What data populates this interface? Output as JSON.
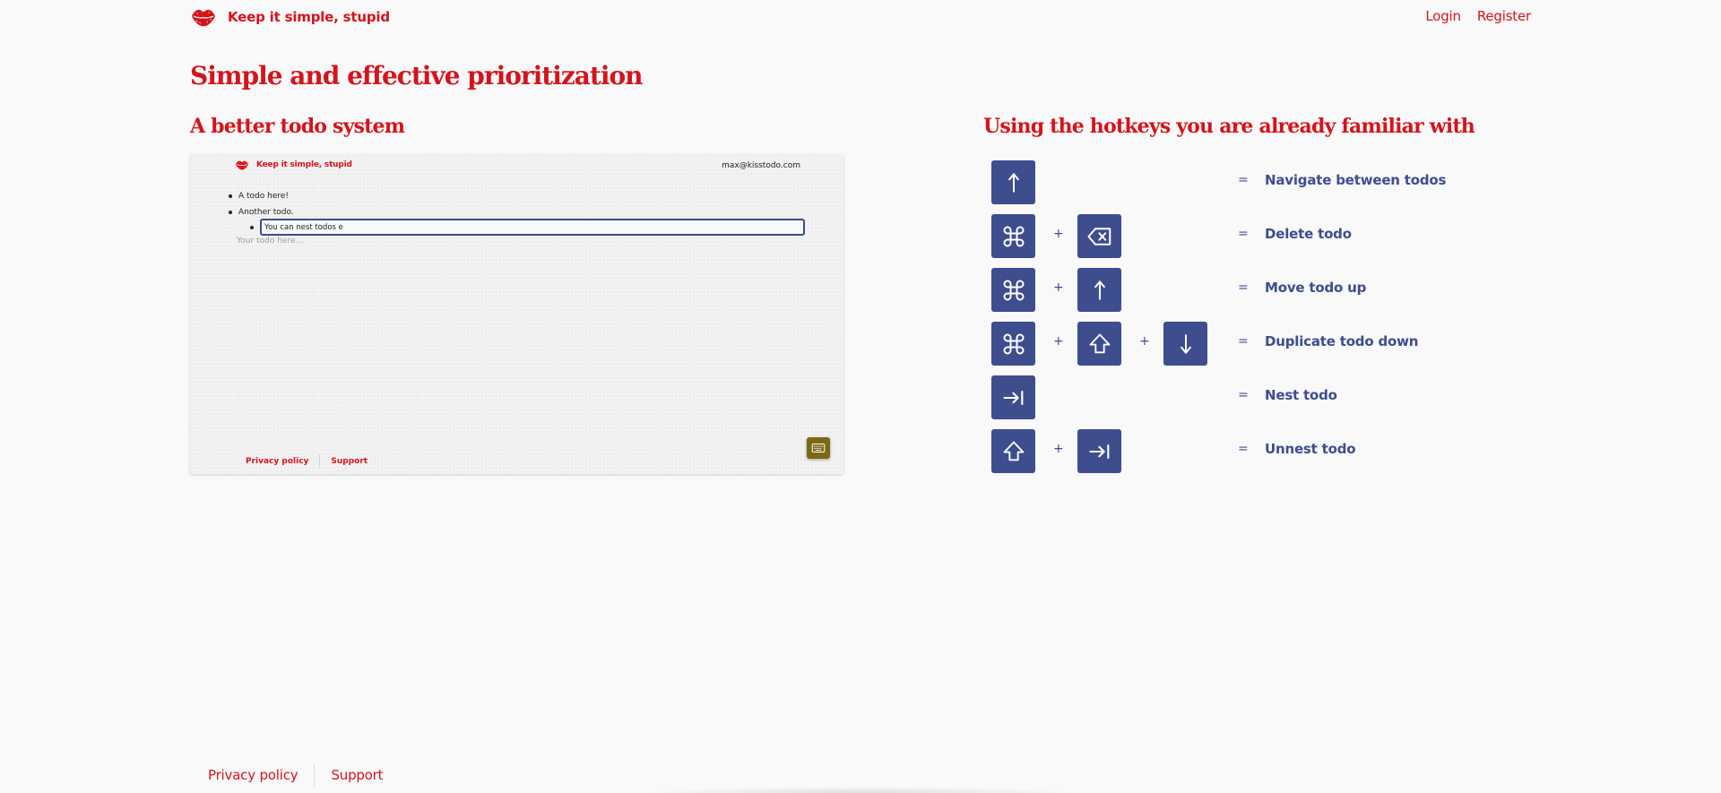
{
  "header": {
    "brand_name": "Keep it simple, stupid",
    "logo_icon": "lips-icon",
    "nav": {
      "login": "Login",
      "register": "Register"
    }
  },
  "hero": {
    "title": "Simple and effective prioritization"
  },
  "left_section": {
    "title": "A better todo system"
  },
  "right_section": {
    "title": "Using the hotkeys you are already familiar with"
  },
  "preview": {
    "brand_name": "Keep it simple, stupid",
    "email": "max@kisstodo.com",
    "todos": [
      "A todo here!",
      "Another todo."
    ],
    "nested_input_value": "You can nest todos e",
    "placeholder": "Your todo here...",
    "footer": {
      "privacy": "Privacy policy",
      "support": "Support"
    },
    "keyboard_button_icon": "keyboard-icon"
  },
  "hotkeys": {
    "plus": "+",
    "equals": "=",
    "rows": [
      {
        "keys": [
          "arrow-up-icon"
        ],
        "description": "Navigate between todos"
      },
      {
        "keys": [
          "command-icon",
          "backspace-icon"
        ],
        "description": "Delete todo"
      },
      {
        "keys": [
          "command-icon",
          "arrow-up-icon"
        ],
        "description": "Move todo up"
      },
      {
        "keys": [
          "command-icon",
          "shift-icon",
          "arrow-down-icon"
        ],
        "description": "Duplicate todo down"
      },
      {
        "keys": [
          "tab-icon"
        ],
        "description": "Nest todo"
      },
      {
        "keys": [
          "shift-icon",
          "tab-icon"
        ],
        "description": "Unnest todo"
      }
    ]
  },
  "footer": {
    "privacy": "Privacy policy",
    "support": "Support"
  },
  "colors": {
    "accent": "#d4141b",
    "key_bg": "#3e4d8e",
    "background": "#f9f9fa",
    "keyboard_button": "#7a6a16"
  }
}
